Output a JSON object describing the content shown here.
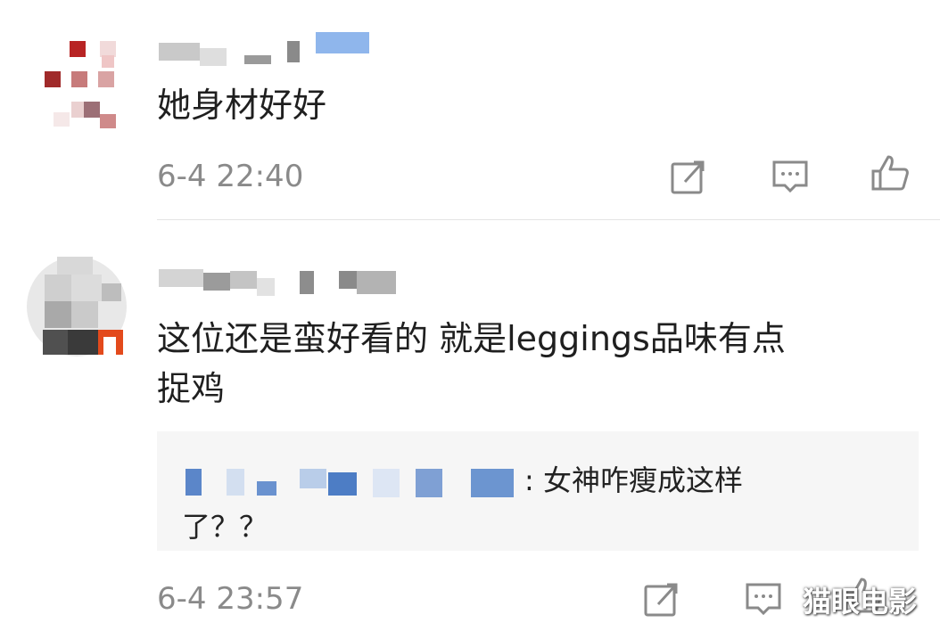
{
  "comments": [
    {
      "text": "她身材好好",
      "time": "6-4 22:40"
    },
    {
      "text_line1": "这位还是蛮好看的 就是leggings品味有点",
      "text_line2": "捉鸡",
      "reply": {
        "text_line1": ": 女神咋瘦成这样",
        "text_line2": "了？？"
      },
      "time": "6-4 23:57"
    }
  ],
  "icons": {
    "forward": "share-edit-icon",
    "comment": "comment-icon",
    "like": "thumbs-up-icon"
  },
  "watermark": "猫眼电影"
}
